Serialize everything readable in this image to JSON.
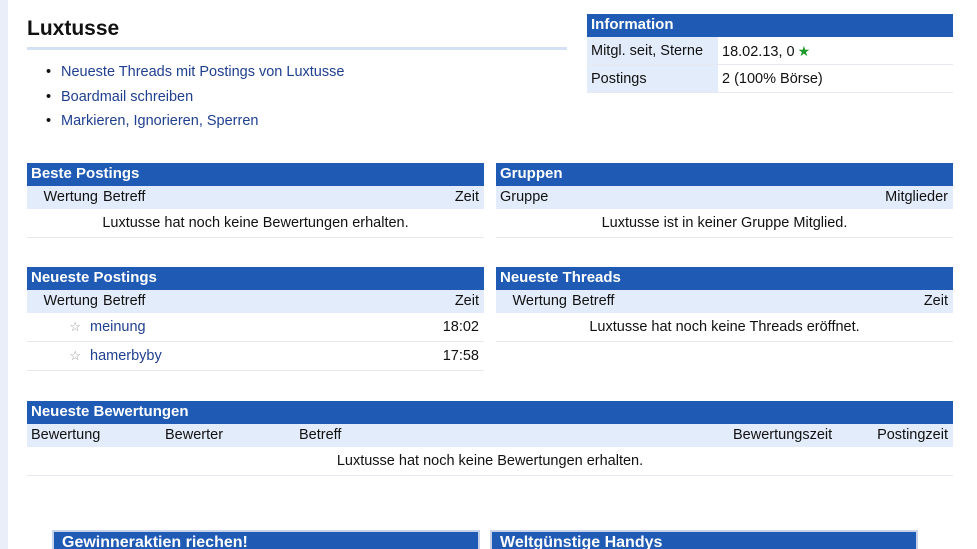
{
  "profile": {
    "username": "Luxtusse",
    "links": [
      "Neueste Threads mit Postings von Luxtusse",
      "Boardmail schreiben",
      "Markieren, Ignorieren, Sperren"
    ]
  },
  "info": {
    "header": "Information",
    "rows": [
      {
        "label": "Mitgl. seit, Sterne",
        "value": "18.02.13, 0",
        "icon": "star-icon"
      },
      {
        "label": "Postings",
        "value": "2 (100% Börse)"
      }
    ]
  },
  "beste_postings": {
    "header": "Beste Postings",
    "columns": [
      "Wertung",
      "Betreff",
      "Zeit"
    ],
    "empty": "Luxtusse hat noch keine Bewertungen erhalten."
  },
  "gruppen": {
    "header": "Gruppen",
    "columns": [
      "Gruppe",
      "Mitglieder"
    ],
    "empty": "Luxtusse ist in keiner Gruppe Mitglied."
  },
  "neueste_postings": {
    "header": "Neueste Postings",
    "columns": [
      "Wertung",
      "Betreff",
      "Zeit"
    ],
    "rows": [
      {
        "icon": "star-outline-icon",
        "subject": "meinung",
        "time": "18:02"
      },
      {
        "icon": "star-outline-icon",
        "subject": "hamerbyby",
        "time": "17:58"
      }
    ]
  },
  "neueste_threads": {
    "header": "Neueste Threads",
    "columns": [
      "Wertung",
      "Betreff",
      "Zeit"
    ],
    "empty": "Luxtusse hat noch keine Threads eröffnet."
  },
  "neueste_bewertungen": {
    "header": "Neueste Bewertungen",
    "columns": [
      "Bewertung",
      "Bewerter",
      "Betreff",
      "Bewertungszeit",
      "Postingzeit"
    ],
    "empty": "Luxtusse hat noch keine Bewertungen erhalten."
  },
  "ads": [
    {
      "title": "Gewinneraktien riechen!"
    },
    {
      "title": "Weltgünstige Handys"
    }
  ],
  "colors": {
    "header_blue": "#1f5ab5",
    "light_blue": "#e3ecfa",
    "link": "#1f3f8f",
    "star_green": "#1e9a2a"
  }
}
